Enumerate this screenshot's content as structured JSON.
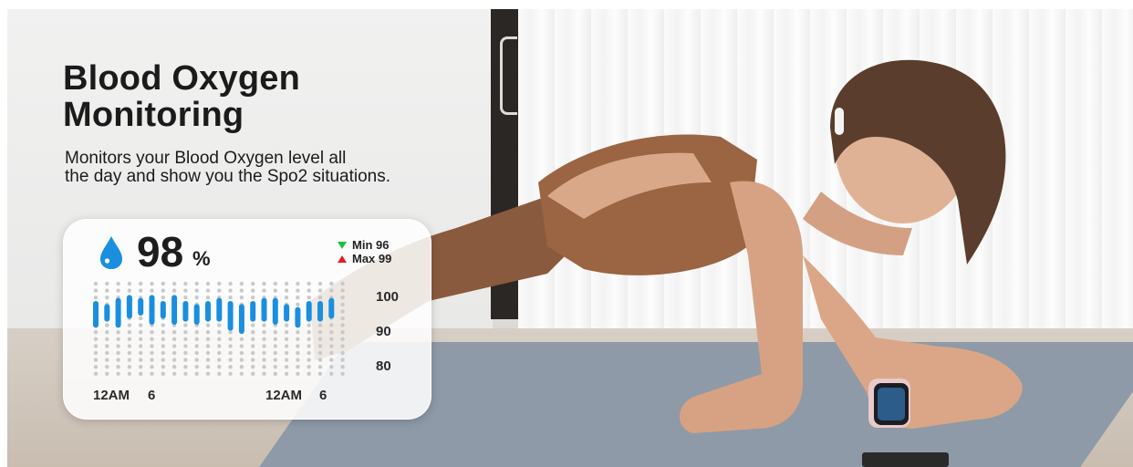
{
  "heading": {
    "title": "Blood Oxygen\nMonitoring",
    "subtitle": "Monitors your Blood Oxygen level all\nthe day and show you the Spo2 situations."
  },
  "card": {
    "value": "98",
    "unit": "%",
    "min_label": "Min 96",
    "max_label": "Max 99",
    "icon": "water-drop-icon",
    "accent_color": "#1a8fdf",
    "min_color": "#1fbf3a",
    "max_color": "#e02020"
  },
  "chart_data": {
    "type": "bar",
    "title": "",
    "xlabel": "",
    "ylabel": "",
    "y_ticks": [
      "100",
      "90",
      "80"
    ],
    "ylim": [
      75,
      105
    ],
    "x_ticks": [
      "12AM",
      "6",
      "12AM",
      "6"
    ],
    "ranges": [
      {
        "low": 92,
        "high": 99
      },
      {
        "low": 94,
        "high": 98
      },
      {
        "low": 92,
        "high": 100
      },
      {
        "low": 95,
        "high": 101
      },
      {
        "low": 96,
        "high": 100
      },
      {
        "low": 93,
        "high": 101
      },
      {
        "low": 95,
        "high": 99
      },
      {
        "low": 93,
        "high": 101
      },
      {
        "low": 94,
        "high": 99
      },
      {
        "low": 93,
        "high": 98
      },
      {
        "low": 94,
        "high": 99
      },
      {
        "low": 94,
        "high": 100
      },
      {
        "low": 91,
        "high": 99
      },
      {
        "low": 90,
        "high": 98
      },
      {
        "low": 94,
        "high": 99
      },
      {
        "low": 94,
        "high": 100
      },
      {
        "low": 93,
        "high": 100
      },
      {
        "low": 94,
        "high": 98
      },
      {
        "low": 92,
        "high": 97
      },
      {
        "low": 94,
        "high": 99
      },
      {
        "low": 94,
        "high": 99
      },
      {
        "low": 95,
        "high": 100
      }
    ]
  }
}
